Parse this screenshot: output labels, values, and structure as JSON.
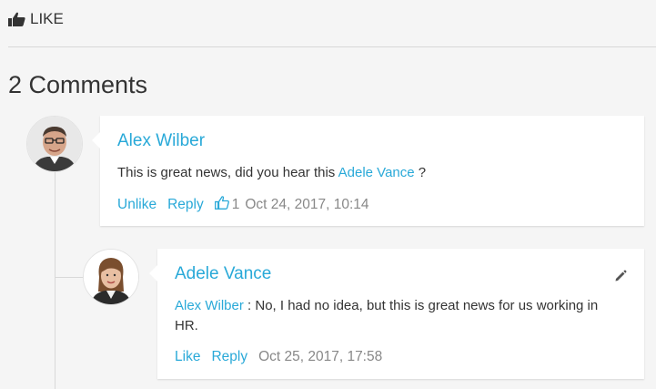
{
  "like_bar": {
    "label": "LIKE",
    "icon": "thumbs-up-icon"
  },
  "comments_header": {
    "title": "2 Comments"
  },
  "comments": [
    {
      "author": "Alex Wilber",
      "text_before": "This is great news, did you hear this",
      "mention": "Adele Vance",
      "text_after": "?",
      "actions": {
        "like": "Unlike",
        "reply": "Reply"
      },
      "like_count": "1",
      "timestamp": "Oct 24, 2017, 10:14"
    },
    {
      "author": "Adele Vance",
      "mention": "Alex Wilber",
      "text_after": ": No, I had no idea, but this is great news for us working in HR.",
      "actions": {
        "like": "Like",
        "reply": "Reply"
      },
      "timestamp": "Oct 25, 2017, 17:58",
      "edit_icon": "pencil-icon"
    }
  ],
  "colors": {
    "link": "#29a9d8",
    "meta": "#888888",
    "background": "#f5f5f5"
  }
}
